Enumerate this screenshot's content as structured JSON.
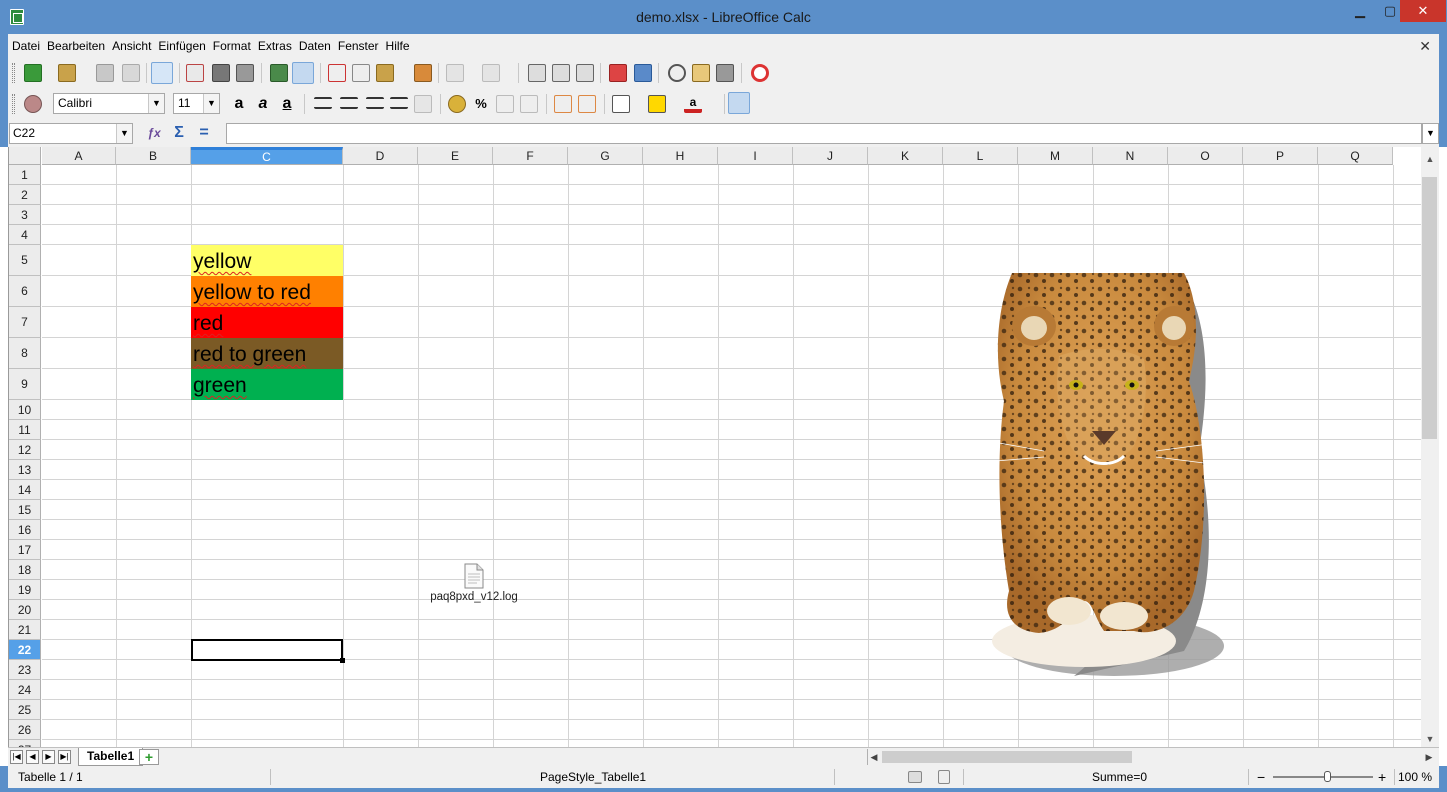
{
  "window": {
    "title": "demo.xlsx - LibreOffice Calc"
  },
  "menu": {
    "items": [
      "Datei",
      "Bearbeiten",
      "Ansicht",
      "Einfügen",
      "Format",
      "Extras",
      "Daten",
      "Fenster",
      "Hilfe"
    ],
    "close_glyph": "✕"
  },
  "toolbar2": {
    "font_name": "Calibri",
    "font_size": "11",
    "percent_symbol": "%"
  },
  "formula": {
    "cell_reference": "C22",
    "value": ""
  },
  "columns": [
    "A",
    "B",
    "C",
    "D",
    "E",
    "F",
    "G",
    "H",
    "I",
    "J",
    "K",
    "L",
    "M",
    "N",
    "O",
    "P",
    "Q"
  ],
  "rows": [
    "1",
    "2",
    "3",
    "4",
    "5",
    "6",
    "7",
    "8",
    "9",
    "10",
    "11",
    "12",
    "13",
    "14",
    "15",
    "16",
    "17",
    "18",
    "19",
    "20",
    "21",
    "22",
    "23",
    "24",
    "25",
    "26",
    "27"
  ],
  "active": {
    "column": "C",
    "row": "22"
  },
  "cells": [
    {
      "ref": "C5",
      "text": "yellow",
      "bg": "#ffff66"
    },
    {
      "ref": "C6",
      "text": "yellow to red",
      "bg": "#ff8000"
    },
    {
      "ref": "C7",
      "text": "red",
      "bg": "#ff0000"
    },
    {
      "ref": "C8",
      "text": "red to green",
      "bg": "#7b5a25"
    },
    {
      "ref": "C9",
      "text": "green",
      "bg": "#00b050"
    }
  ],
  "embedded_file": {
    "name": "paq8pxd_v12.log",
    "icon": "text-file-icon"
  },
  "embedded_image": {
    "subject": "jaguar-image"
  },
  "sheet_tabs": {
    "active": "Tabelle1",
    "add_glyph": "+"
  },
  "status": {
    "sheet_position": "Tabelle 1 / 1",
    "page_style": "PageStyle_Tabelle1",
    "sum": "Summe=0",
    "zoom": "100 %",
    "zoom_minus": "−",
    "zoom_plus": "+"
  },
  "colors": {
    "chrome": "#5b8fc9",
    "active_header": "#55a0e8",
    "close_button": "#c9352b"
  }
}
